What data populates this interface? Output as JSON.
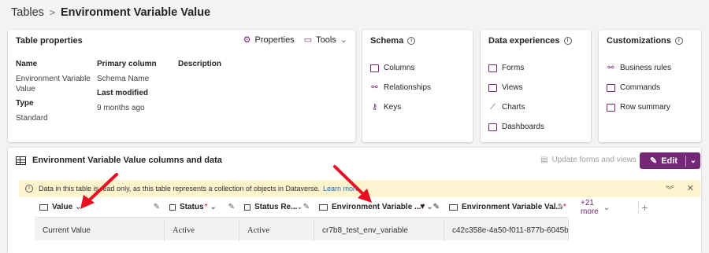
{
  "breadcrumb": {
    "root": "Tables",
    "separator": ">",
    "current": "Environment Variable Value"
  },
  "table_properties": {
    "title": "Table properties",
    "properties_label": "Properties",
    "tools_label": "Tools",
    "name_label": "Name",
    "name_value_line1": "Environment Variable",
    "name_value_line2": "Value",
    "type_label": "Type",
    "type_value": "Standard",
    "primary_column_label": "Primary column",
    "primary_column_value": "Schema Name",
    "last_modified_label": "Last modified",
    "last_modified_value": "9 months ago",
    "description_label": "Description"
  },
  "schema": {
    "title": "Schema",
    "items": [
      "Columns",
      "Relationships",
      "Keys"
    ]
  },
  "data_experiences": {
    "title": "Data experiences",
    "items": [
      "Forms",
      "Views",
      "Charts",
      "Dashboards"
    ]
  },
  "customizations": {
    "title": "Customizations",
    "items": [
      "Business rules",
      "Commands",
      "Row summary"
    ]
  },
  "panel": {
    "title": "Environment Variable Value columns and data",
    "update_label": "Update forms and views",
    "edit_label": "Edit",
    "banner_text": "Data in this table is read only, as this table represents a collection of objects in Dataverse.",
    "banner_link": "Learn more"
  },
  "grid": {
    "columns": [
      {
        "label": "Value",
        "required": "",
        "suffix": "⌄"
      },
      {
        "label": "Status",
        "required": "*",
        "suffix": "⌄"
      },
      {
        "label": "Status Re...",
        "required": "",
        "suffix": ""
      },
      {
        "label": "Environment Variable ...",
        "required": "*",
        "suffix": ""
      },
      {
        "label": "Environment Variable Val...",
        "required": "*",
        "suffix": ""
      }
    ],
    "more_columns": "+21 more",
    "row": [
      "Current Value",
      "Active",
      "Active",
      "cr7b8_test_env_variable",
      "c42c358e-4a50-f011-877b-6045b..."
    ]
  },
  "colors": {
    "accent": "#742774",
    "arrow": "#e81123",
    "banner": "#fff4ce"
  }
}
